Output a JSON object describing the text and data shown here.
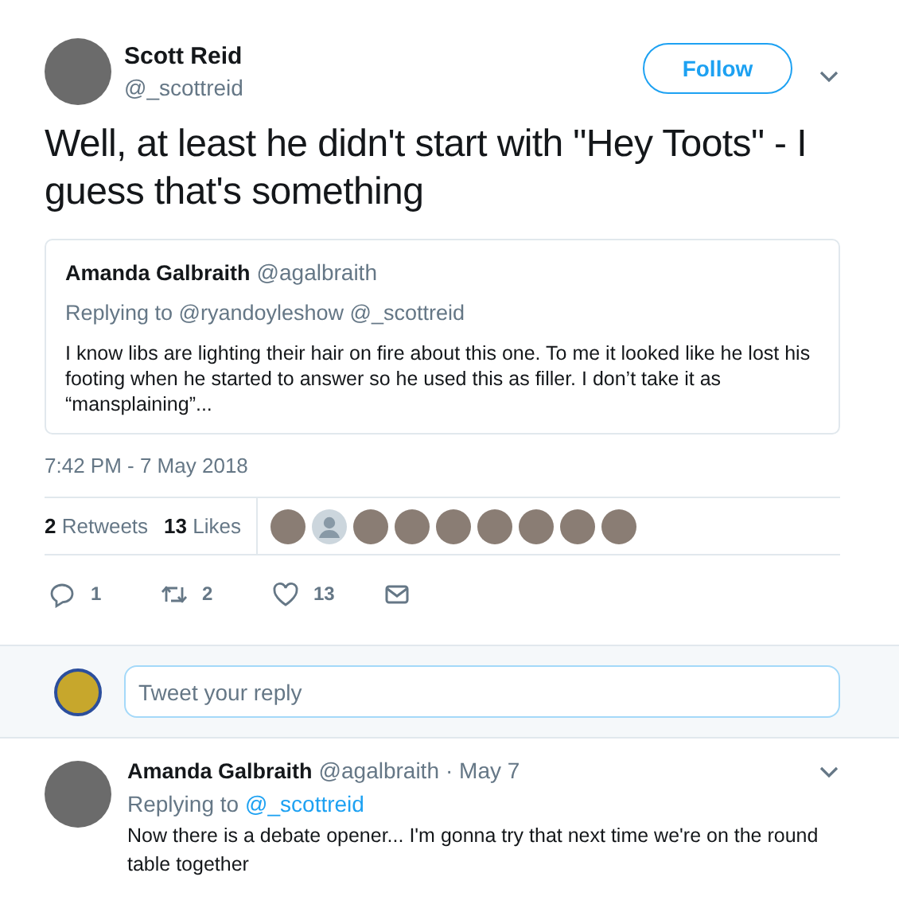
{
  "tweet": {
    "name": "Scott Reid",
    "handle": "@_scottreid",
    "follow_button": "Follow",
    "text": "Well, at least he didn't start with \"Hey Toots\" - I guess that's something"
  },
  "quoted_tweet": {
    "name": "Amanda Galbraith",
    "handle": "@agalbraith",
    "replying_to": "Replying to @ryandoyleshow @_scottreid",
    "text": "I know libs are lighting their hair on fire about this one. To me it looked like he lost his footing when he started to answer so he used this as filler. I don’t take it as “mansplaining”..."
  },
  "timestamp": "7:42 PM - 7 May 2018",
  "stats": [
    {
      "count": "2",
      "label": "Retweets"
    },
    {
      "count": "13",
      "label": "Likes"
    }
  ],
  "likers": [
    {
      "kind": "photo"
    },
    {
      "kind": "default"
    },
    {
      "kind": "photo"
    },
    {
      "kind": "photo"
    },
    {
      "kind": "photo"
    },
    {
      "kind": "photo"
    },
    {
      "kind": "photo"
    },
    {
      "kind": "photo"
    },
    {
      "kind": "photo"
    }
  ],
  "actions": [
    {
      "kind": "reply",
      "count": "1"
    },
    {
      "kind": "retweet",
      "count": "2"
    },
    {
      "kind": "like",
      "count": "13"
    },
    {
      "kind": "message"
    }
  ],
  "reply_box": {
    "placeholder": "Tweet your reply"
  },
  "replies": [
    {
      "name": "Amanda Galbraith",
      "handle": "@agalbraith",
      "date": "· May 7",
      "replying_label": "Replying to",
      "replying_handle": "@_scottreid",
      "text": "Now there is a debate opener... I'm gonna try that next time we're on the round table together"
    }
  ]
}
